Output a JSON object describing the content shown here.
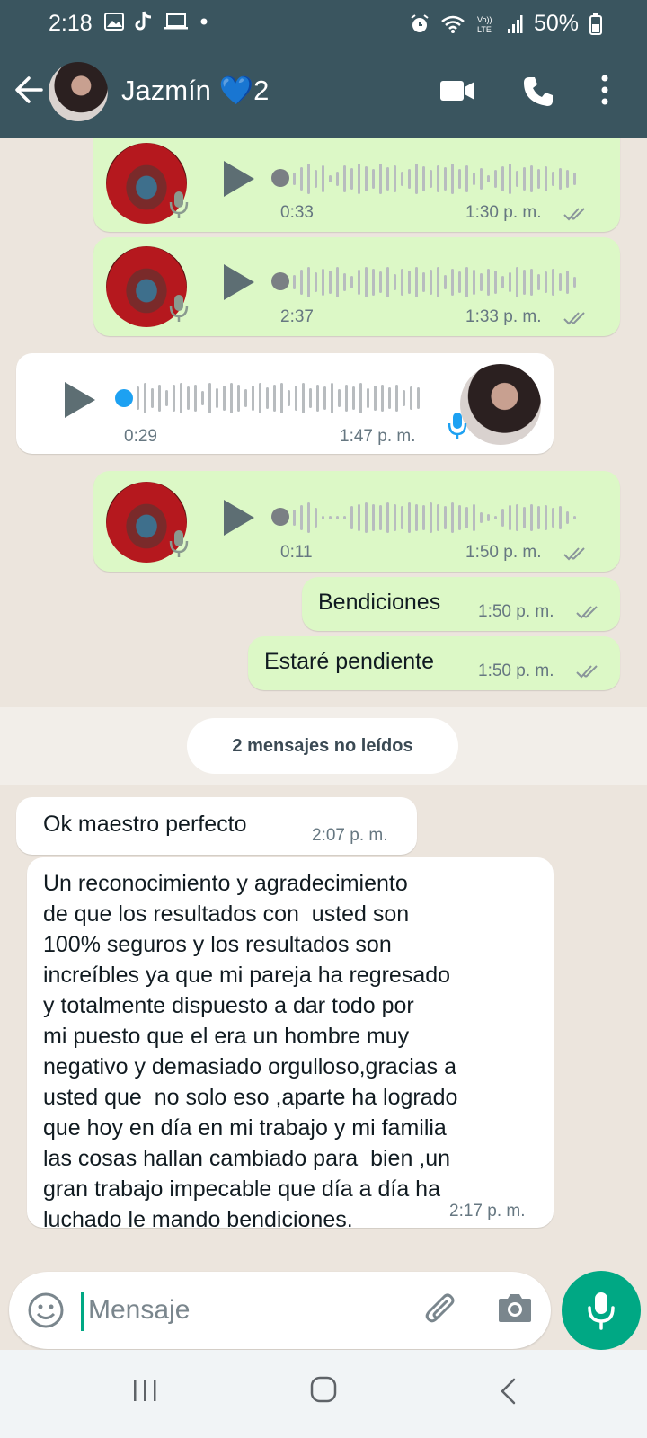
{
  "status_bar": {
    "time": "2:18",
    "battery_percent": "50%",
    "icons": [
      "image-icon",
      "tiktok-icon",
      "laptop-icon",
      "dot-icon",
      "alarm-icon",
      "wifi-icon",
      "volte-icon",
      "signal-icon",
      "battery-icon"
    ]
  },
  "header": {
    "contact_name": "Jazmín 💙2",
    "icons": [
      "back-arrow-icon",
      "video-call-icon",
      "voice-call-icon",
      "more-options-icon"
    ]
  },
  "messages": [
    {
      "type": "voice",
      "direction": "outgoing",
      "duration": "0:33",
      "time": "1:30 p. m.",
      "status": "read"
    },
    {
      "type": "voice",
      "direction": "outgoing",
      "duration": "2:37",
      "time": "1:33 p. m.",
      "status": "read"
    },
    {
      "type": "voice",
      "direction": "incoming",
      "duration": "0:29",
      "time": "1:47 p. m."
    },
    {
      "type": "voice",
      "direction": "outgoing",
      "duration": "0:11",
      "time": "1:50 p. m.",
      "status": "read"
    },
    {
      "type": "text",
      "direction": "outgoing",
      "text": "Bendiciones",
      "time": "1:50 p. m.",
      "status": "read"
    },
    {
      "type": "text",
      "direction": "outgoing",
      "text": "Estaré pendiente",
      "time": "1:50 p. m.",
      "status": "read"
    }
  ],
  "unread_separator": "2 mensajes no leídos",
  "incoming_messages": [
    {
      "type": "text",
      "text": "Ok maestro perfecto",
      "time": "2:07 p. m."
    },
    {
      "type": "text",
      "text": "Un reconocimiento y agradecimiento\nde que los resultados con  usted son\n100% seguros y los resultados son\nincreíbles ya que mi pareja ha regresado\ny totalmente dispuesto a dar todo por\nmi puesto que el era un hombre muy\nnegativo y demasiado orgulloso,gracias a\nusted que  no solo eso ,aparte ha logrado\nque hoy en día en mi trabajo y mi familia\nlas cosas hallan cambiado para  bien ,un\ngran trabajo impecable que día a día ha\nluchado le mando bendiciones.",
      "time": "2:17 p. m."
    }
  ],
  "composer": {
    "placeholder": "Mensaje",
    "icons": [
      "emoji-icon",
      "attach-icon",
      "camera-icon",
      "mic-icon"
    ]
  },
  "colors": {
    "header_bg": "#3a555f",
    "outgoing_bubble": "#dcf8c6",
    "incoming_bubble": "#ffffff",
    "accent": "#00a884",
    "voice_dot_incoming": "#1da1f2",
    "voice_dot_outgoing": "#7a7f84"
  }
}
